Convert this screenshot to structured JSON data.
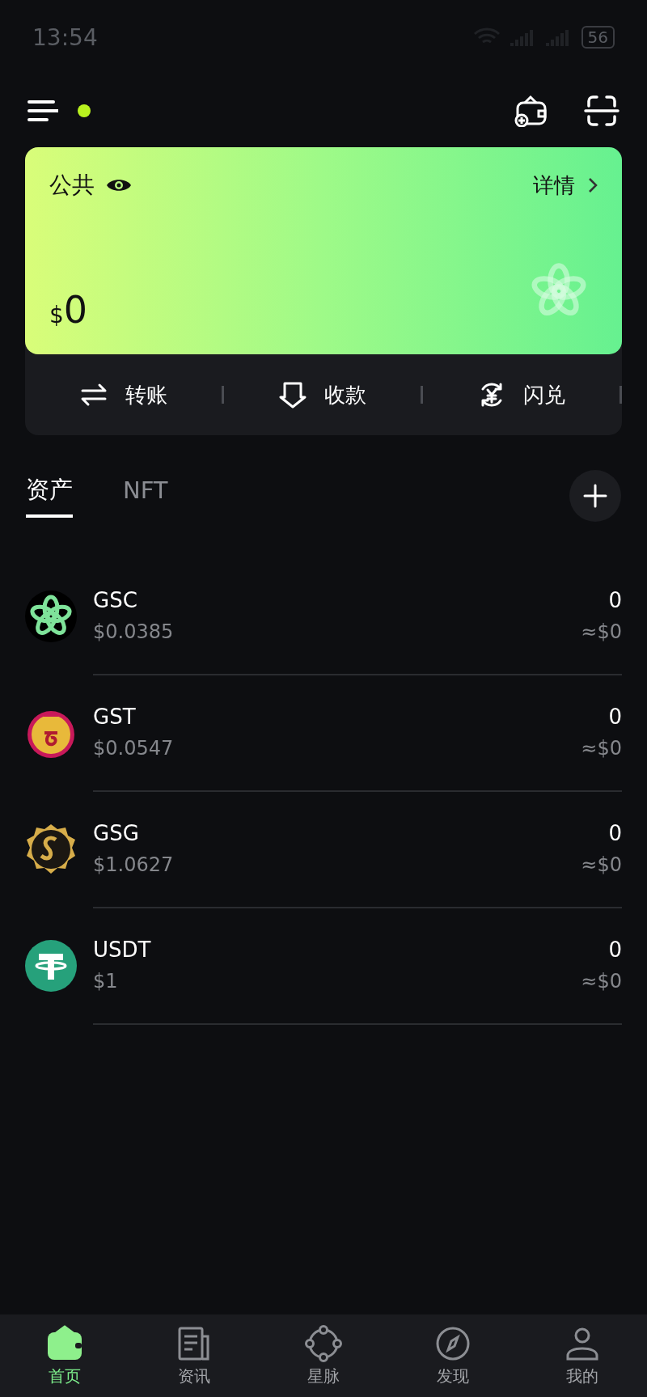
{
  "status_bar": {
    "time": "13:54",
    "battery": "56"
  },
  "wallet_card": {
    "name": "公共",
    "details": "详情",
    "currency": "$",
    "balance": "0"
  },
  "actions": [
    {
      "kind": "transfer",
      "label": "转账"
    },
    {
      "kind": "receive",
      "label": "收款"
    },
    {
      "kind": "swap",
      "label": "闪兑"
    }
  ],
  "tabs": [
    {
      "label": "资产",
      "selected": true
    },
    {
      "label": "NFT",
      "selected": false
    }
  ],
  "assets": [
    {
      "kind": "gsc",
      "symbol": "GSC",
      "price": "$0.0385",
      "amount": "0",
      "value": "≈$0"
    },
    {
      "kind": "gst",
      "symbol": "GST",
      "price": "$0.0547",
      "amount": "0",
      "value": "≈$0"
    },
    {
      "kind": "gsg",
      "symbol": "GSG",
      "price": "$1.0627",
      "amount": "0",
      "value": "≈$0"
    },
    {
      "kind": "usdt",
      "symbol": "USDT",
      "price": "$1",
      "amount": "0",
      "value": "≈$0"
    }
  ],
  "bottom_nav": [
    {
      "kind": "wallet",
      "label": "首页",
      "selected": true
    },
    {
      "kind": "news",
      "label": "资讯",
      "selected": false
    },
    {
      "kind": "network",
      "label": "星脉",
      "selected": false
    },
    {
      "kind": "compass",
      "label": "发现",
      "selected": false
    },
    {
      "kind": "person",
      "label": "我的",
      "selected": false
    }
  ]
}
